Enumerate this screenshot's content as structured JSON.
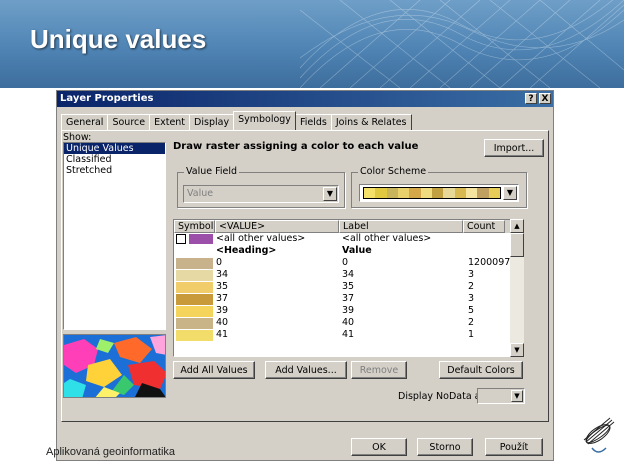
{
  "slide": {
    "title": "Unique values",
    "footer": "Aplikovaná geoinformatika"
  },
  "dialog": {
    "title": "Layer Properties",
    "help_btn": "?",
    "close_btn": "X",
    "tabs": [
      "General",
      "Source",
      "Extent",
      "Display",
      "Symbology",
      "Fields",
      "Joins & Relates"
    ],
    "active_tab": "Symbology",
    "show_label": "Show:",
    "show_items": [
      "Unique Values",
      "Classified",
      "Stretched"
    ],
    "selected_show": "Unique Values",
    "heading": "Draw raster assigning a color to each value",
    "import_btn": "Import...",
    "value_field": {
      "legend": "Value Field",
      "value": "Value"
    },
    "color_scheme": {
      "legend": "Color Scheme",
      "colors": [
        "#f5e06a",
        "#e0c840",
        "#c8b45a",
        "#e8d06a",
        "#d4a848",
        "#f0dc80",
        "#c0a040",
        "#e8d898",
        "#d8b850",
        "#f4e4a0",
        "#bfa060",
        "#e8cc58"
      ]
    },
    "table": {
      "columns": [
        "Symbol",
        "<VALUE>",
        "Label",
        "Count"
      ],
      "rows": [
        {
          "value": "<all other values>",
          "label": "<all other values>",
          "count": "",
          "color": "#9b4fa8",
          "type": "other"
        },
        {
          "value": "<Heading>",
          "label": "Value",
          "count": "",
          "color": "",
          "type": "heading"
        },
        {
          "value": "0",
          "label": "0",
          "count": "1200097",
          "color": "#c8b28c"
        },
        {
          "value": "34",
          "label": "34",
          "count": "3",
          "color": "#e6d9a4"
        },
        {
          "value": "35",
          "label": "35",
          "count": "2",
          "color": "#f0cc6a"
        },
        {
          "value": "37",
          "label": "37",
          "count": "3",
          "color": "#c89a3a"
        },
        {
          "value": "39",
          "label": "39",
          "count": "5",
          "color": "#f5d45c"
        },
        {
          "value": "40",
          "label": "40",
          "count": "2",
          "color": "#c8b486"
        },
        {
          "value": "41",
          "label": "41",
          "count": "1",
          "color": "#f2dc6a"
        }
      ]
    },
    "buttons": {
      "add_all": "Add All Values",
      "add_values": "Add Values...",
      "remove": "Remove",
      "default_colors": "Default Colors",
      "ok": "OK",
      "cancel": "Storno",
      "apply": "Použít"
    },
    "nodata_label": "Display NoData as"
  }
}
